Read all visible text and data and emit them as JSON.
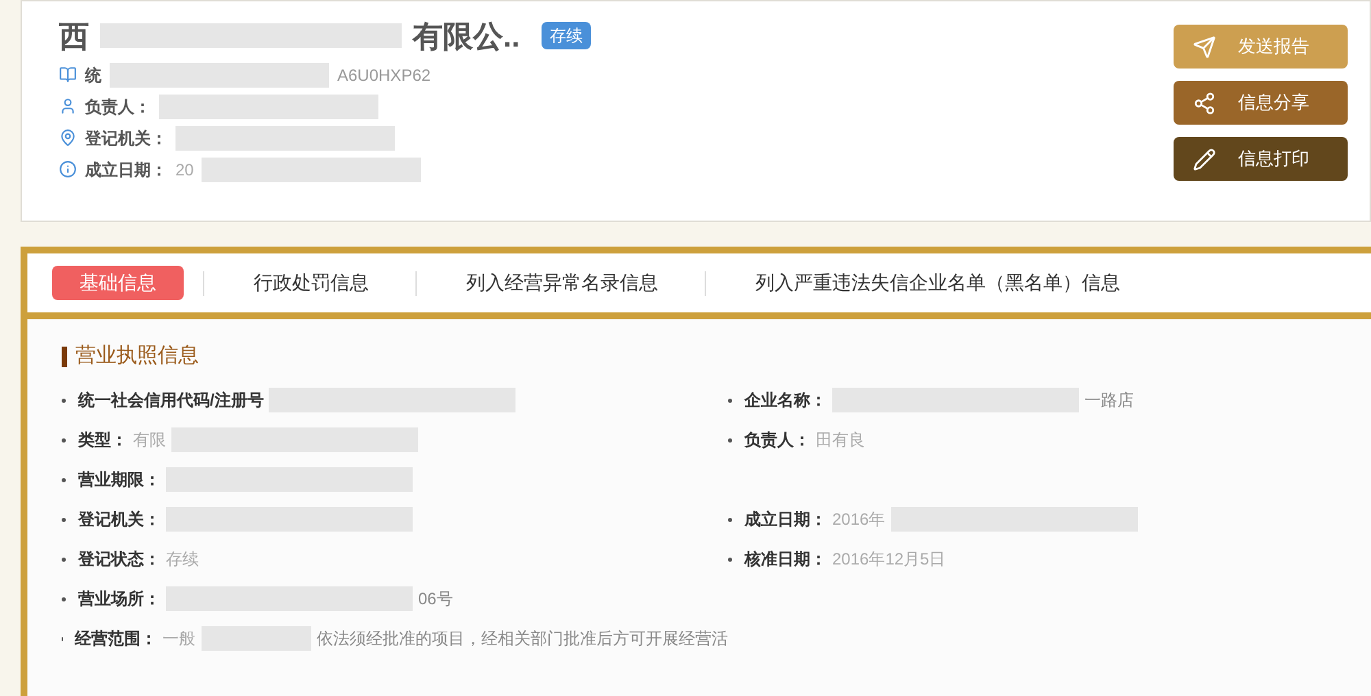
{
  "header": {
    "name_start": "西",
    "name_redacted": true,
    "name_end": "有限公..",
    "status_badge": "存续",
    "info": [
      {
        "label": "统",
        "redacted": true,
        "value_end": "A6U0HXP62"
      },
      {
        "label": "负责人：",
        "redacted": true
      },
      {
        "label": "登记机关：",
        "redacted": true
      },
      {
        "label": "成立日期：",
        "value": "20",
        "redacted": true
      }
    ]
  },
  "actions": [
    {
      "kind": "send",
      "label": "发送报告",
      "color": "#cd9f50"
    },
    {
      "kind": "share",
      "label": "信息分享",
      "color": "#9a6629"
    },
    {
      "kind": "print",
      "label": "信息打印",
      "color": "#62471c"
    }
  ],
  "tabs": [
    {
      "label": "基础信息",
      "selected": true
    },
    {
      "label": "行政处罚信息",
      "selected": false
    },
    {
      "label": "列入经营异常名录信息",
      "selected": false
    },
    {
      "label": "列入严重违法失信企业名单（黑名单）信息",
      "selected": false
    }
  ],
  "section": {
    "title": "营业执照信息",
    "rows": [
      {
        "left": {
          "label": "统一社会信用代码/注册号",
          "redacted": true
        },
        "right": {
          "label": "企业名称：",
          "redacted": true,
          "value_end": "一路店"
        }
      },
      {
        "left": {
          "label": "类型：",
          "value": "有限",
          "redacted": true
        },
        "right": {
          "label": "负责人：",
          "value": "田有良",
          "redacted": false
        }
      },
      {
        "left": {
          "label": "营业期限：",
          "redacted": true
        }
      },
      {
        "left": {
          "label": "登记机关：",
          "redacted": true
        },
        "right": {
          "label": "成立日期：",
          "value": "2016年",
          "redacted": true
        }
      },
      {
        "left": {
          "label": "登记状态：",
          "value": "存续",
          "redacted": false
        },
        "right": {
          "label": "核准日期：",
          "value": "2016年12月5日",
          "redacted": false
        }
      },
      {
        "left": {
          "label": "营业场所：",
          "redacted": true,
          "value_end": "06号"
        }
      },
      {
        "left": {
          "label": "经营范围：",
          "value": "一般",
          "redacted": true,
          "value_end": "依法须经批准的项目，经相关部门批准后方可开展经营活"
        }
      }
    ]
  }
}
